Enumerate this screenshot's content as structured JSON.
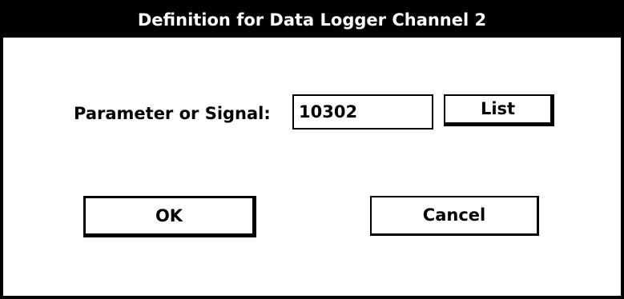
{
  "window": {
    "title": "Definition for Data Logger Channel 2"
  },
  "form": {
    "parameter_label": "Parameter or Signal:",
    "parameter_value": "10302"
  },
  "buttons": {
    "list_label": "List",
    "ok_label": "OK",
    "cancel_label": "Cancel"
  }
}
